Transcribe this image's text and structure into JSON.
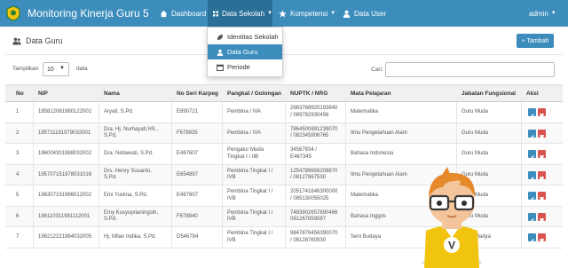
{
  "app": {
    "title": "Monitoring Kinerja Guru 5"
  },
  "nav": {
    "dashboard": "Dashboard",
    "data_sekolah": "Data Sekolah",
    "kompetensi": "Kompetensi",
    "data_user": "Data User",
    "user": "admin"
  },
  "dropdown": {
    "items": [
      {
        "label": "Identitas Sekolah",
        "icon": "leaf-icon"
      },
      {
        "label": "Data Guru",
        "icon": "user-icon"
      },
      {
        "label": "Periode",
        "icon": "calendar-icon"
      }
    ]
  },
  "panel": {
    "title": "Data Guru",
    "add_button": "+ Tambah"
  },
  "table_controls": {
    "show_label": "Tampilkan",
    "page_length": "10",
    "entries_label": "data",
    "search_label": "Cari:",
    "search_value": ""
  },
  "table": {
    "headers": [
      "No",
      "NIP",
      "Nama",
      "No Seri Karpeg",
      "Pangkat / Golongan",
      "NUPTK / NRG",
      "Mata Pelajaran",
      "Jabatan Fungsional",
      "Aksi"
    ],
    "rows": [
      {
        "no": "1",
        "nip": "195812081980122002",
        "nama": [
          "Aryati, S.Pd."
        ],
        "karpeg": "E890721",
        "pangkat": [
          "Pembina / IVA"
        ],
        "nuptk": [
          "2983768920193840",
          "/ 089782930456"
        ],
        "mapel": "Matematika",
        "jabatan": "Guru Muda"
      },
      {
        "no": "2",
        "nip": "195711191979032001",
        "nama": [
          "Dra. Hj. Nurhayati.HS.,",
          "S.Pd."
        ],
        "karpeg": "F678935",
        "pangkat": [
          "Pembina / IVA"
        ],
        "nuptk": [
          "7864500891239070",
          "/ 082345906765"
        ],
        "mapel": "Ilmu Pengetahuan Alam",
        "jabatan": "Guru Muda"
      },
      {
        "no": "3",
        "nip": "196004301988032002",
        "nama": [
          "Dra. Netiawati, S.Pd."
        ],
        "karpeg": "E467607",
        "pangkat": [
          "Pengatur Muda",
          "Tingkat I / IIB"
        ],
        "nuptk": [
          "34567834 /",
          "E467345"
        ],
        "mapel": "Bahasa Indonesia",
        "jabatan": "Guru Muda"
      },
      {
        "no": "4",
        "nip": "195707151978031016",
        "nama": [
          "Drs. Henry Susanto,",
          "S.Pd."
        ],
        "karpeg": "E654897",
        "pangkat": [
          "Pembina Tingkat I /",
          "IVB"
        ],
        "nuptk": [
          "1254789656209870",
          "/ 08127867530"
        ],
        "mapel": "Ilmu Pengetahuan Alam",
        "jabatan": "Guru Muda"
      },
      {
        "no": "5",
        "nip": "196307191986012002",
        "nama": [
          "Emi Yuslina, S.Pd."
        ],
        "karpeg": "E467607",
        "pangkat": [
          "Pembina Tingkat I /",
          "IVB"
        ],
        "nuptk": [
          "2051741646300000",
          "/ 085130055025"
        ],
        "mapel": "Matematika",
        "jabatan": "Guru Muda"
      },
      {
        "no": "6",
        "nip": "196110311981112001",
        "nama": [
          "Emy Kusyuprianingsih,",
          "S.Pd."
        ],
        "karpeg": "F678940",
        "pangkat": [
          "Pembina Tingkat I /",
          "IVB"
        ],
        "nuptk": [
          "7483902657890466",
          "081267859087"
        ],
        "mapel": "Bahasa Inggris",
        "jabatan": "Guru Muda"
      },
      {
        "no": "7",
        "nip": "196212221984032005",
        "nama": [
          "Hj. Milan Indika, S.Pd."
        ],
        "karpeg": "D546784",
        "pangkat": [
          "Pembina Tingkat I /",
          "IVB"
        ],
        "nuptk": [
          "9847876456390070",
          "/ 08128760930"
        ],
        "mapel": "Seni Budaya",
        "jabatan": "Guru Madya"
      }
    ]
  },
  "colors": {
    "primary": "#3c8dbc",
    "danger": "#d9534f"
  },
  "mascot": {
    "letter": "V"
  }
}
